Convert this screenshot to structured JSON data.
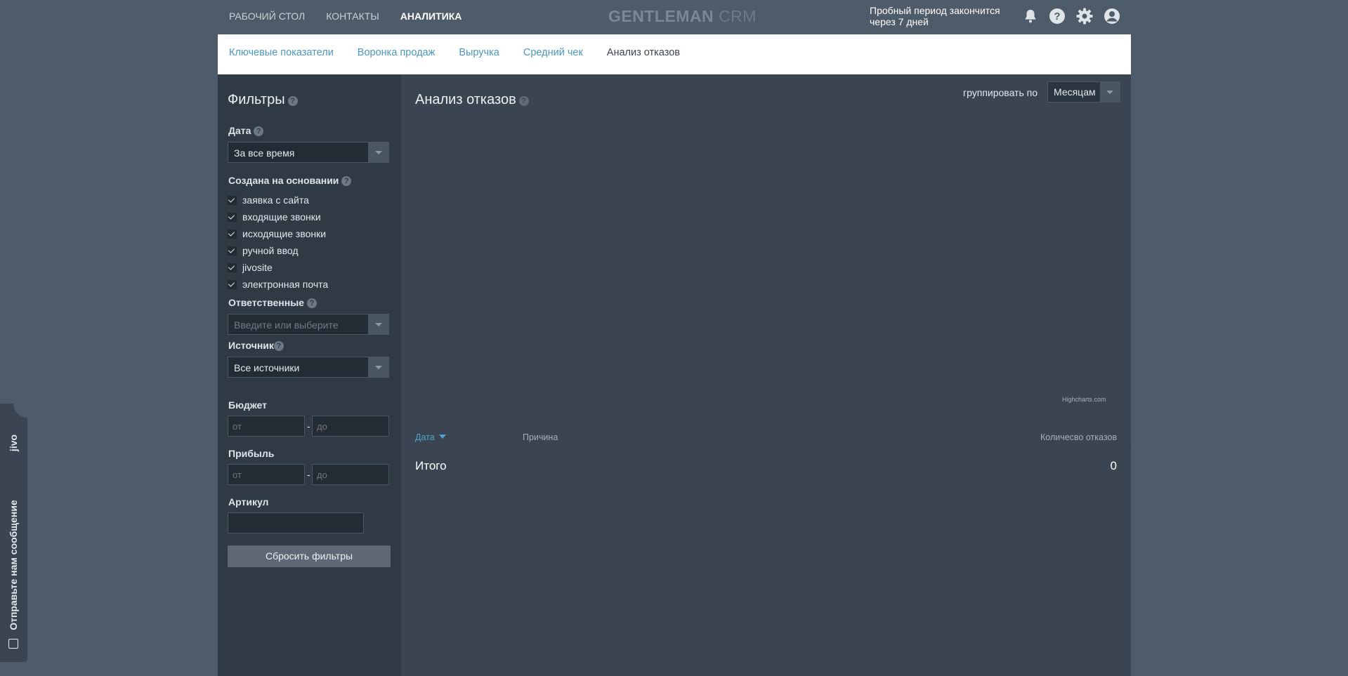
{
  "nav": {
    "items": [
      {
        "label": "РАБОЧИЙ СТОЛ"
      },
      {
        "label": "КОНТАКТЫ"
      },
      {
        "label": "АНАЛИТИКА",
        "active": true
      }
    ]
  },
  "logo": {
    "part1": "GENTLEMAN",
    "part2": "CRM"
  },
  "trial": {
    "line1": "Пробный период закончится",
    "line2": "через 7 дней"
  },
  "top_icons": [
    "bell-icon",
    "help-icon",
    "gear-icon",
    "user-avatar-icon"
  ],
  "tabs": [
    {
      "label": "Ключевые показатели"
    },
    {
      "label": "Воронка продаж"
    },
    {
      "label": "Выручка"
    },
    {
      "label": "Средний чек"
    },
    {
      "label": "Анализ отказов",
      "active": true
    }
  ],
  "filters": {
    "title": "Фильтры",
    "help": "?",
    "date": {
      "label": "Дата",
      "value": "За все время"
    },
    "created_on": {
      "label": "Создана на основании",
      "options": [
        {
          "label": "заявка с сайта",
          "checked": true
        },
        {
          "label": "входящие звонки",
          "checked": true
        },
        {
          "label": "исходящие звонки",
          "checked": true
        },
        {
          "label": "ручной ввод",
          "checked": true
        },
        {
          "label": "jivosite",
          "checked": true
        },
        {
          "label": "электронная почта",
          "checked": true
        }
      ]
    },
    "responsible": {
      "label": "Ответственные",
      "placeholder": "Введите или выберите"
    },
    "source": {
      "label": "Источник",
      "value": "Все источники"
    },
    "budget": {
      "label": "Бюджет",
      "from_placeholder": "от",
      "to_placeholder": "до"
    },
    "profit": {
      "label": "Прибыль",
      "from_placeholder": "от",
      "to_placeholder": "до"
    },
    "article": {
      "label": "Артикул",
      "value": ""
    },
    "separator": "-",
    "reset_label": "Сбросить фильтры"
  },
  "main": {
    "title": "Анализ отказов",
    "group_label": "группировать по",
    "group_value": "Месяцам",
    "chart_credit": "Highcharts.com",
    "table": {
      "columns": [
        "Дата",
        "Причина",
        "Количесво отказов"
      ],
      "total_label": "Итого",
      "total_value": "0"
    }
  },
  "jivo": {
    "brand": "jivo",
    "message": "Отправьте нам сообщение"
  },
  "colors": {
    "accent": "#4a98bd",
    "background": "#4e5b68",
    "panel": "#3a4551",
    "sidebar": "#2f3a45"
  }
}
